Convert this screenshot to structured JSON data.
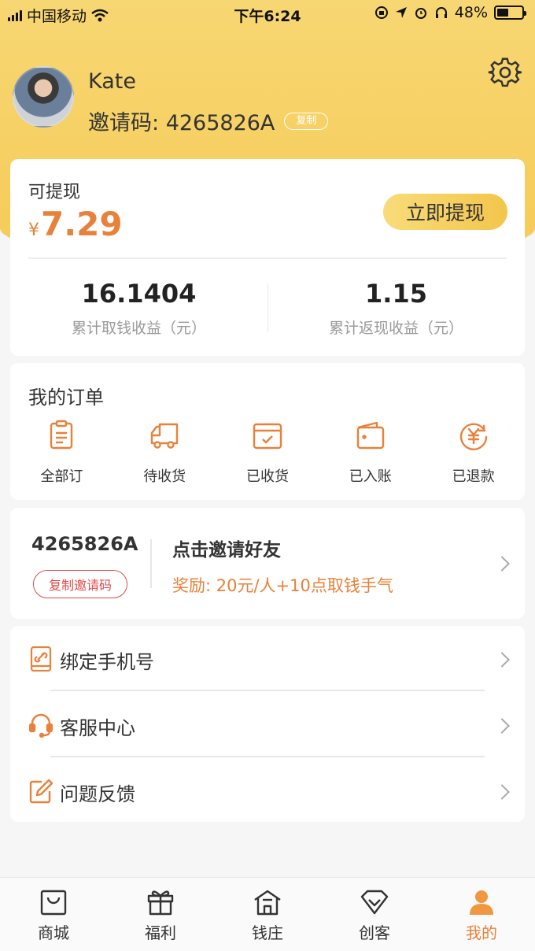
{
  "status_bar": {
    "carrier": "中国移动",
    "time": "下午6:24",
    "battery": "48%",
    "battery_level": 0.48
  },
  "profile": {
    "name": "Kate",
    "invite_label": "邀请码: ",
    "invite_code": "4265826A",
    "copy_label": "复制"
  },
  "balance": {
    "label": "可提现",
    "currency": "¥",
    "amount": "7.29",
    "withdraw_button": "立即提现",
    "stats": [
      {
        "value": "16.1404",
        "label": "累计取钱收益（元）"
      },
      {
        "value": "1.15",
        "label": "累计返现收益（元）"
      }
    ]
  },
  "orders": {
    "title": "我的订单",
    "items": [
      {
        "label": "全部订",
        "icon": "clipboard-icon"
      },
      {
        "label": "待收货",
        "icon": "truck-icon"
      },
      {
        "label": "已收货",
        "icon": "box-check-icon"
      },
      {
        "label": "已入账",
        "icon": "wallet-icon"
      },
      {
        "label": "已退款",
        "icon": "yen-refund-icon"
      }
    ]
  },
  "invite": {
    "code": "4265826A",
    "copy_button": "复制邀请码",
    "title": "点击邀请好友",
    "reward": "奖励: 20元/人+10点取钱手气"
  },
  "menu": {
    "items": [
      {
        "label": "绑定手机号",
        "icon": "phone-link-icon"
      },
      {
        "label": "客服中心",
        "icon": "headset-icon"
      },
      {
        "label": "问题反馈",
        "icon": "edit-icon"
      }
    ]
  },
  "tabbar": {
    "items": [
      {
        "label": "商城",
        "icon": "shopping-bag-icon"
      },
      {
        "label": "福利",
        "icon": "gift-icon"
      },
      {
        "label": "钱庄",
        "icon": "house-icon"
      },
      {
        "label": "创客",
        "icon": "diamond-icon"
      },
      {
        "label": "我的",
        "icon": "person-icon",
        "active": true
      }
    ]
  },
  "colors": {
    "accent": "#e8813a",
    "header_yellow": "#f6cb57",
    "danger": "#e04b4b"
  }
}
